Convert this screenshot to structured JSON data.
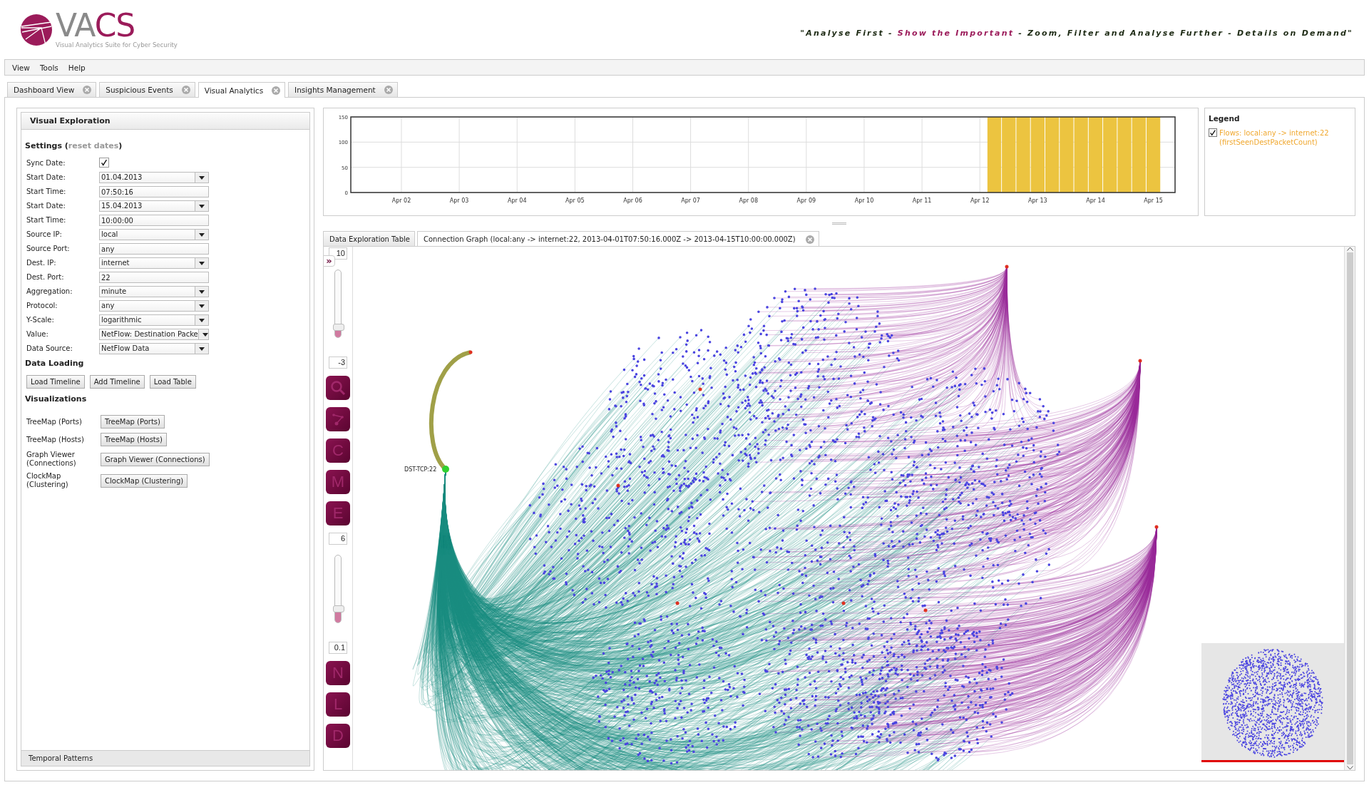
{
  "header": {
    "logo_grey": "VA",
    "logo_accent": "CS",
    "subtitle": "Visual Analytics Suite for Cyber Security",
    "tagline": [
      {
        "text": "\"Analyse First - ",
        "highlight": false
      },
      {
        "text": "Show the Important",
        "highlight": true
      },
      {
        "text": " - Zoom, Filter and Analyse Further - Details on Demand\"",
        "highlight": false
      }
    ]
  },
  "menu": [
    "View",
    "Tools",
    "Help"
  ],
  "tabs": [
    {
      "label": "Dashboard View",
      "selected": false
    },
    {
      "label": "Suspicious Events",
      "selected": false
    },
    {
      "label": "Visual Analytics",
      "selected": true
    },
    {
      "label": "Insights Management",
      "selected": false
    }
  ],
  "panel": {
    "title": "Visual Exploration",
    "settings_before": "Settings (",
    "reset_link": "reset dates",
    "settings_after": ")",
    "fields": [
      {
        "label": "Sync Date:",
        "kind": "checkbox",
        "checked": true
      },
      {
        "label": "Start Date:",
        "kind": "dropdown",
        "value": "01.04.2013"
      },
      {
        "label": "Start Time:",
        "kind": "text",
        "value": "07:50:16"
      },
      {
        "label": "Start Date:",
        "kind": "dropdown",
        "value": "15.04.2013"
      },
      {
        "label": "Start Time:",
        "kind": "text",
        "value": "10:00:00"
      },
      {
        "label": "Source IP:",
        "kind": "dropdown",
        "value": "local"
      },
      {
        "label": "Source Port:",
        "kind": "text",
        "value": "any"
      },
      {
        "label": "Dest. IP:",
        "kind": "dropdown",
        "value": "internet"
      },
      {
        "label": "Dest. Port:",
        "kind": "text",
        "value": "22"
      },
      {
        "label": "Aggregation:",
        "kind": "dropdown",
        "value": "minute"
      },
      {
        "label": "Protocol:",
        "kind": "dropdown",
        "value": "any"
      },
      {
        "label": "Y-Scale:",
        "kind": "dropdown",
        "value": "logarithmic"
      },
      {
        "label": "Value:",
        "kind": "dropdown",
        "value": "NetFlow: Destination Packe"
      },
      {
        "label": "Data Source:",
        "kind": "dropdown",
        "value": "NetFlow Data"
      }
    ],
    "loading_title": "Data Loading",
    "loading_buttons": [
      "Load Timeline",
      "Add Timeline",
      "Load Table"
    ],
    "vis_title": "Visualizations",
    "visualizations": [
      {
        "label": "TreeMap (Ports)",
        "button": "TreeMap (Ports)"
      },
      {
        "label": "TreeMap (Hosts)",
        "button": "TreeMap (Hosts)"
      },
      {
        "label": "Graph Viewer (Connections)",
        "button": "Graph Viewer (Connections)"
      },
      {
        "label": "ClockMap (Clustering)",
        "button": "ClockMap (Clustering)"
      }
    ],
    "footer": "Temporal Patterns"
  },
  "timeline": {
    "chart_data": {
      "type": "bar",
      "ylim": [
        0,
        150
      ],
      "categories": [
        null,
        null,
        null,
        "Apr 02",
        null,
        null,
        null,
        "Apr 03",
        null,
        null,
        null,
        "Apr 04",
        null,
        null,
        null,
        "Apr 05",
        null,
        null,
        null,
        "Apr 06",
        null,
        null,
        null,
        "Apr 07",
        null,
        null,
        null,
        "Apr 08",
        null,
        null,
        null,
        "Apr 09",
        null,
        null,
        null,
        "Apr 10",
        null,
        null,
        null,
        "Apr 11",
        null,
        null,
        null,
        "Apr 12",
        null,
        null,
        null,
        "Apr 13",
        null,
        null,
        null,
        "Apr 14",
        null,
        null,
        null,
        "Apr 15",
        null
      ],
      "yticks": [
        0,
        50,
        100,
        150
      ],
      "series": [
        {
          "color": "#ecc440",
          "values": [
            0,
            0,
            0,
            0,
            0,
            0,
            0,
            0,
            0,
            0,
            0,
            0,
            0,
            0,
            0,
            0,
            0,
            0,
            0,
            0,
            0,
            0,
            0,
            0,
            0,
            0,
            0,
            0,
            0,
            0,
            0,
            0,
            0,
            0,
            0,
            0,
            0,
            0,
            0,
            0,
            0,
            0,
            0,
            0,
            150,
            150,
            150,
            150,
            150,
            150,
            150,
            150,
            150,
            150,
            150,
            150,
            0
          ]
        }
      ],
      "grid": true
    }
  },
  "legend": {
    "title": "Legend",
    "items": [
      {
        "label": "Flows: local:any -> internet:22 (firstSeenDestPacketCount)",
        "checked": true,
        "color": "#f0a830"
      }
    ]
  },
  "graph_tabs": [
    {
      "label": "Data Exploration Table",
      "selected": false,
      "closable": false
    },
    {
      "label": "Connection Graph (local:any -> internet:22, 2013-04-01T07:50:16.000Z -> 2013-04-15T10:00:00.000Z)",
      "selected": true,
      "closable": true
    }
  ],
  "toolbar": [
    {
      "kind": "number",
      "value": "10"
    },
    {
      "kind": "expand",
      "text": "»"
    },
    {
      "kind": "slider",
      "level": 0.15
    },
    {
      "kind": "number",
      "value": "-3"
    },
    {
      "kind": "search"
    },
    {
      "kind": "graph"
    },
    {
      "kind": "letter",
      "text": "C"
    },
    {
      "kind": "letter",
      "text": "M"
    },
    {
      "kind": "letter",
      "text": "E"
    },
    {
      "kind": "number",
      "value": "6"
    },
    {
      "kind": "slider",
      "level": 0.2
    },
    {
      "kind": "number",
      "value": "0.1"
    },
    {
      "kind": "letter",
      "text": "N"
    },
    {
      "kind": "letter",
      "text": "L"
    },
    {
      "kind": "letter",
      "text": "D"
    }
  ],
  "graph": {
    "node_label": "DST-TCP:22"
  }
}
